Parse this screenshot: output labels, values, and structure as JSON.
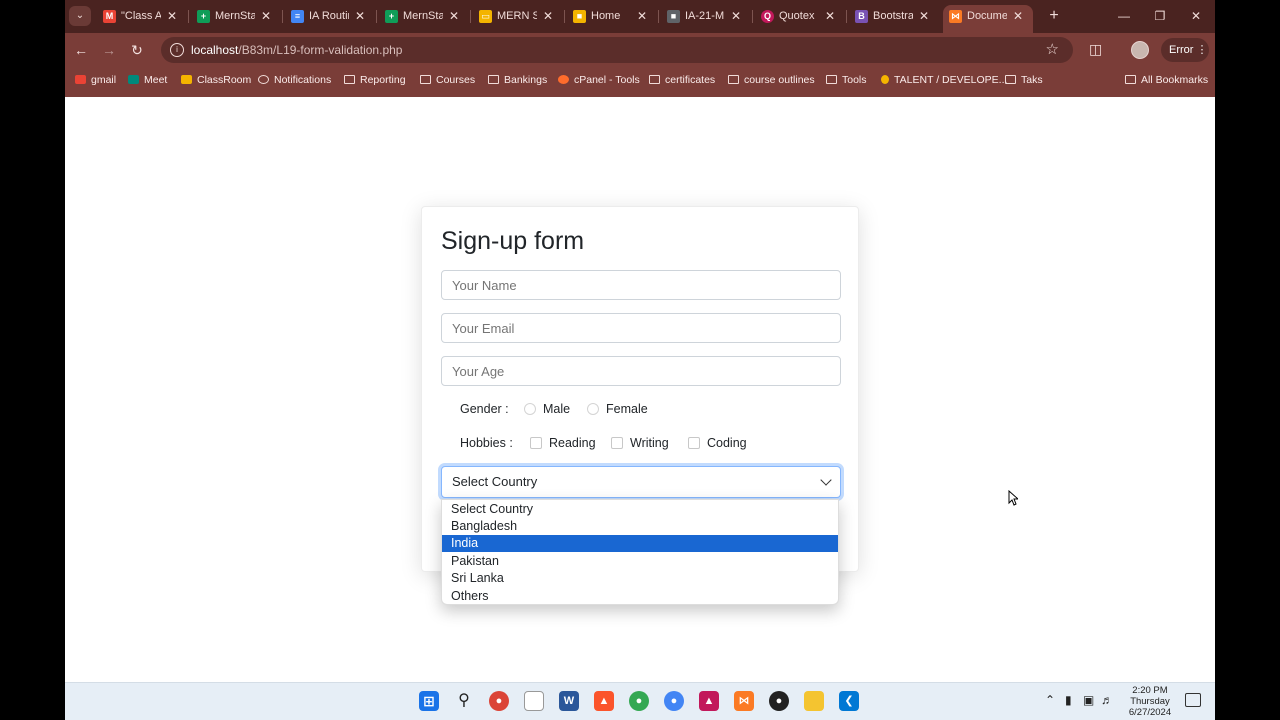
{
  "browser": {
    "tabs": [
      {
        "label": "\"Class At",
        "icon": "gmail-icon",
        "color": "#ea4335"
      },
      {
        "label": "MernSta",
        "icon": "sheets-icon",
        "color": "#0f9d58"
      },
      {
        "label": "IA Routir",
        "icon": "docs-icon",
        "color": "#4285f4"
      },
      {
        "label": "MernSta",
        "icon": "sheets-icon",
        "color": "#0f9d58"
      },
      {
        "label": "MERN St",
        "icon": "slides-icon",
        "color": "#f4b400"
      },
      {
        "label": "Home",
        "icon": "classroom-icon",
        "color": "#1e8e3e"
      },
      {
        "label": "IA-21-M",
        "icon": "contact-icon",
        "color": "#5f6368"
      },
      {
        "label": "Quotex",
        "icon": "quotex-icon",
        "color": "#c2185b"
      },
      {
        "label": "Bootstra",
        "icon": "bootstrap-icon",
        "color": "#7952b3"
      },
      {
        "label": "Docume",
        "icon": "xampp-icon",
        "color": "#fb7a24"
      }
    ],
    "address": {
      "host": "localhost",
      "path": "/B83m/L19-form-validation.php"
    },
    "error_label": "Error",
    "bookmarks": [
      {
        "label": "gmail",
        "icon": "gmail-icon"
      },
      {
        "label": "Meet",
        "icon": "meet-icon"
      },
      {
        "label": "ClassRoom",
        "icon": "classroom-icon"
      },
      {
        "label": "Notifications",
        "icon": "globe-icon"
      },
      {
        "label": "Reporting",
        "icon": "folder-icon"
      },
      {
        "label": "Courses",
        "icon": "folder-icon"
      },
      {
        "label": "Bankings",
        "icon": "folder-icon"
      },
      {
        "label": "cPanel - Tools",
        "icon": "cpanel-icon"
      },
      {
        "label": "certificates",
        "icon": "folder-icon"
      },
      {
        "label": "course outlines",
        "icon": "folder-icon"
      },
      {
        "label": "Tools",
        "icon": "folder-icon"
      },
      {
        "label": "TALENT / DEVELOPE...",
        "icon": "talent-icon"
      },
      {
        "label": "Taks",
        "icon": "folder-icon"
      }
    ],
    "all_bookmarks_label": "All Bookmarks"
  },
  "form": {
    "title": "Sign-up form",
    "name_placeholder": "Your Name",
    "email_placeholder": "Your Email",
    "age_placeholder": "Your Age",
    "gender_label": "Gender :",
    "gender_options": [
      "Male",
      "Female"
    ],
    "hobbies_label": "Hobbies :",
    "hobby_options": [
      "Reading",
      "Writing",
      "Coding"
    ],
    "country_selected": "Select Country",
    "country_options": [
      "Select Country",
      "Bangladesh",
      "India",
      "Pakistan",
      "Sri Lanka",
      "Others"
    ],
    "highlighted_option": "India"
  },
  "taskbar": {
    "time": "2:20 PM",
    "day": "Thursday",
    "date": "6/27/2024"
  }
}
